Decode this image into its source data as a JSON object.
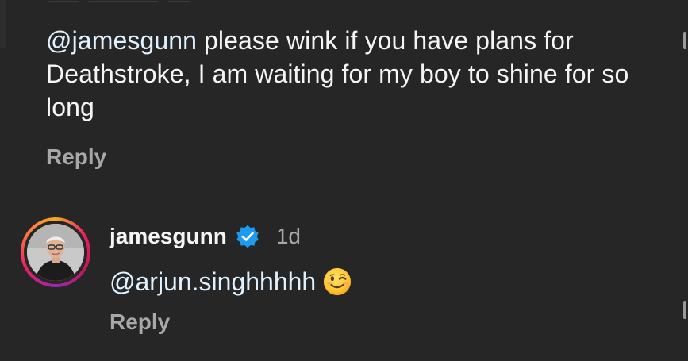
{
  "parent_comment": {
    "mention": "@jamesgunn",
    "text": " please wink if you have plans for Deathstroke, I am waiting for my boy to shine for so long",
    "reply_label": "Reply"
  },
  "reply_comment": {
    "username": "jamesgunn",
    "verified": true,
    "time": "1d",
    "mention": "@arjun.singhhhhh",
    "emoji": "winking-face",
    "reply_label": "Reply"
  },
  "colors": {
    "background": "#262626",
    "text": "#f5f5f5",
    "secondary_text": "#a8a8a8",
    "verified_badge": "#1d9bf0"
  }
}
